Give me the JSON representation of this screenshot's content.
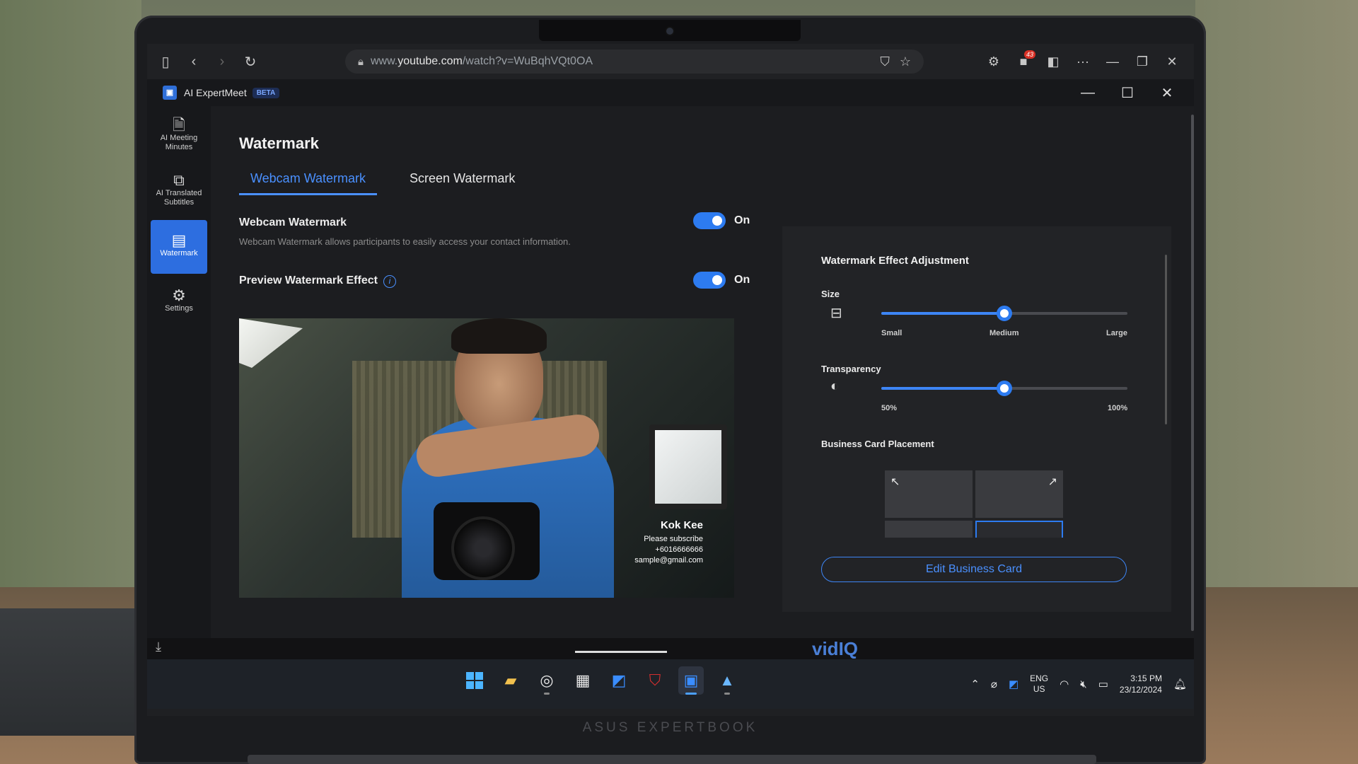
{
  "browser": {
    "url_prefix": "www.",
    "url_domain": "youtube.com",
    "url_path": "/watch?v=WuBqhVQt0OA",
    "notification_count": "43"
  },
  "app": {
    "name": "AI ExpertMeet",
    "badge": "BETA"
  },
  "sidebar": {
    "items": [
      {
        "label": "AI Meeting Minutes",
        "icon": "document-icon"
      },
      {
        "label": "AI Translated Subtitles",
        "icon": "subtitles-icon"
      },
      {
        "label": "Watermark",
        "icon": "watermark-icon",
        "active": true
      },
      {
        "label": "Settings",
        "icon": "gear-icon"
      }
    ]
  },
  "main": {
    "title": "Watermark",
    "tabs": [
      {
        "label": "Webcam Watermark",
        "active": true
      },
      {
        "label": "Screen Watermark",
        "active": false
      }
    ],
    "webcam_watermark": {
      "label": "Webcam Watermark",
      "description": "Webcam Watermark allows participants to easily access your contact information.",
      "state": "On"
    },
    "preview_effect": {
      "label": "Preview Watermark Effect",
      "state": "On"
    },
    "card": {
      "name": "Kok Kee",
      "line1": "Please subscribe",
      "line2": "+6016666666",
      "line3": "sample@gmail.com"
    }
  },
  "panel": {
    "title": "Watermark Effect Adjustment",
    "size": {
      "label": "Size",
      "ticks": [
        "Small",
        "Medium",
        "Large"
      ],
      "value_fraction": 0.5
    },
    "transparency": {
      "label": "Transparency",
      "ticks": [
        "50%",
        "100%"
      ],
      "value_fraction": 0.5
    },
    "placement": {
      "label": "Business Card Placement",
      "selected": "bottom-right"
    },
    "edit_button": "Edit Business Card"
  },
  "taskbar": {
    "lang_top": "ENG",
    "lang_bottom": "US",
    "time": "3:15 PM",
    "date": "23/12/2024"
  },
  "device": {
    "brand": "ASUS EXPERTBOOK"
  },
  "behind": {
    "vidiq": "vidIQ"
  },
  "colors": {
    "accent": "#2d7bf0",
    "background": "#1c1d20",
    "panel": "#222326"
  }
}
